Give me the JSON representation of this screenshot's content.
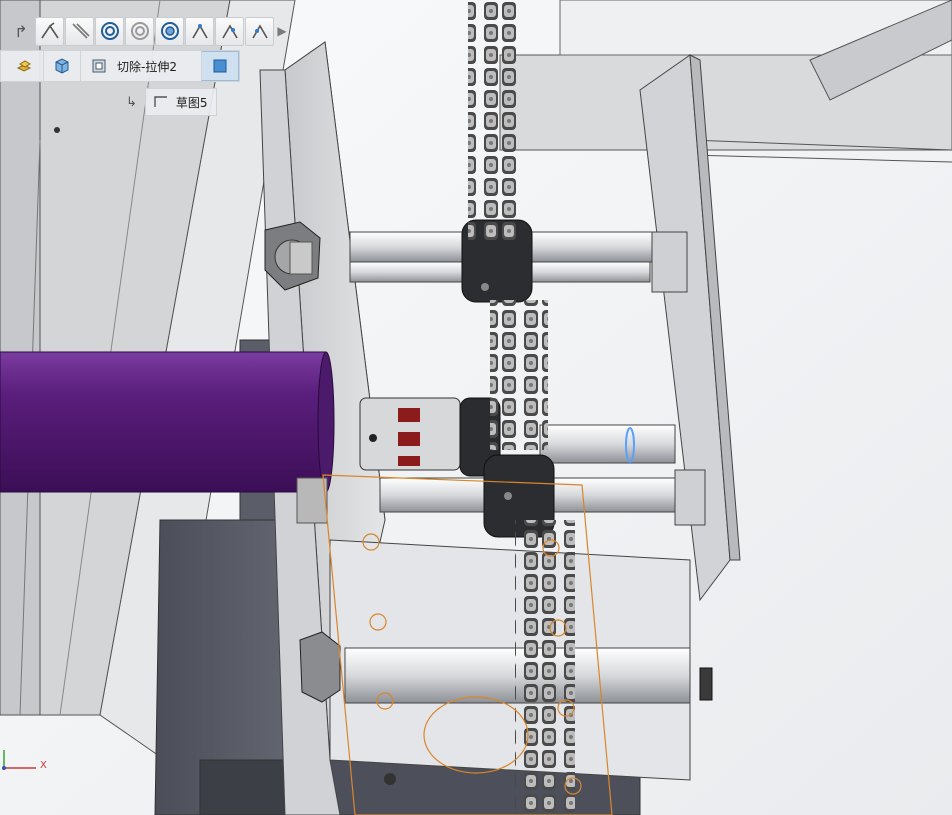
{
  "toolbar": {
    "items": [
      {
        "name": "smart-dimension-icon"
      },
      {
        "name": "line-icon"
      },
      {
        "name": "concentric-icon"
      },
      {
        "name": "concentric-gray-icon"
      },
      {
        "name": "concentric-outline-icon"
      },
      {
        "name": "fix-relation-icon"
      },
      {
        "name": "perpendicular-relation-icon"
      },
      {
        "name": "coincident-relation-icon"
      }
    ]
  },
  "breadcrumb": {
    "feature_label": "切除-拉伸2",
    "sketch_label": "草图5"
  },
  "triad": {
    "x_label": "X"
  },
  "colors": {
    "accent": "#cfe0f1",
    "highlight_orange": "#d8862c",
    "tube_purple": "#5a1e7c",
    "selection_blue": "#5aa0ff"
  }
}
